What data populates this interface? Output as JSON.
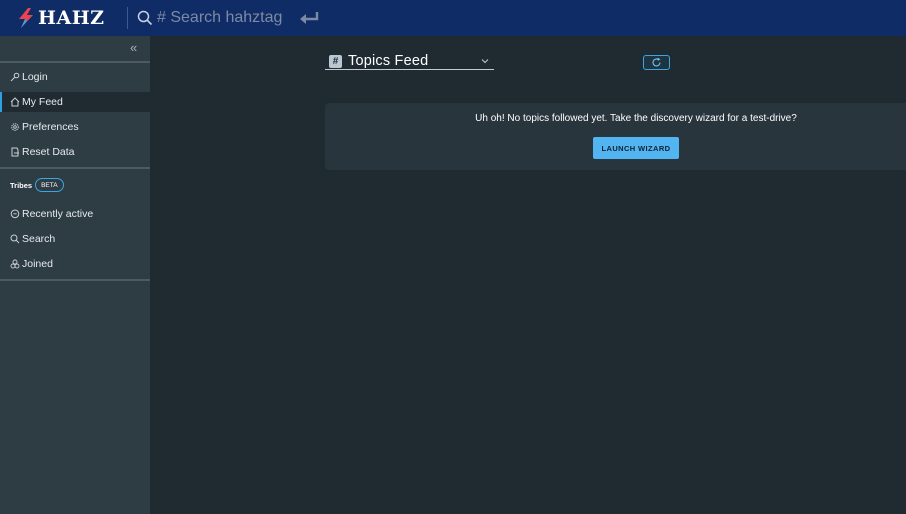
{
  "header": {
    "logo_text": "HAHZ",
    "search_placeholder": "# Search hahztag"
  },
  "sidebar": {
    "items": [
      {
        "label": "Login",
        "icon": "key-icon"
      },
      {
        "label": "My Feed",
        "icon": "home-icon",
        "active": true
      },
      {
        "label": "Preferences",
        "icon": "gear-icon"
      },
      {
        "label": "Reset Data",
        "icon": "reset-icon"
      }
    ],
    "tribes_label": "Tribes",
    "beta_label": "BETA",
    "tribe_items": [
      {
        "label": "Recently active",
        "icon": "chat-icon"
      },
      {
        "label": "Search",
        "icon": "search-icon"
      },
      {
        "label": "Joined",
        "icon": "group-icon"
      }
    ]
  },
  "main": {
    "feed_hash": "#",
    "feed_title": "Topics Feed",
    "empty_message": "Uh oh! No topics followed yet. Take the discovery wizard for a test-drive?",
    "launch_label": "LAUNCH WIZARD"
  },
  "colors": {
    "header_bg": "#0f2c66",
    "sidebar_bg": "#2e3c44",
    "main_bg": "#1f2a31",
    "accent": "#52b4f0",
    "logo_bolt": "#e8434f"
  }
}
